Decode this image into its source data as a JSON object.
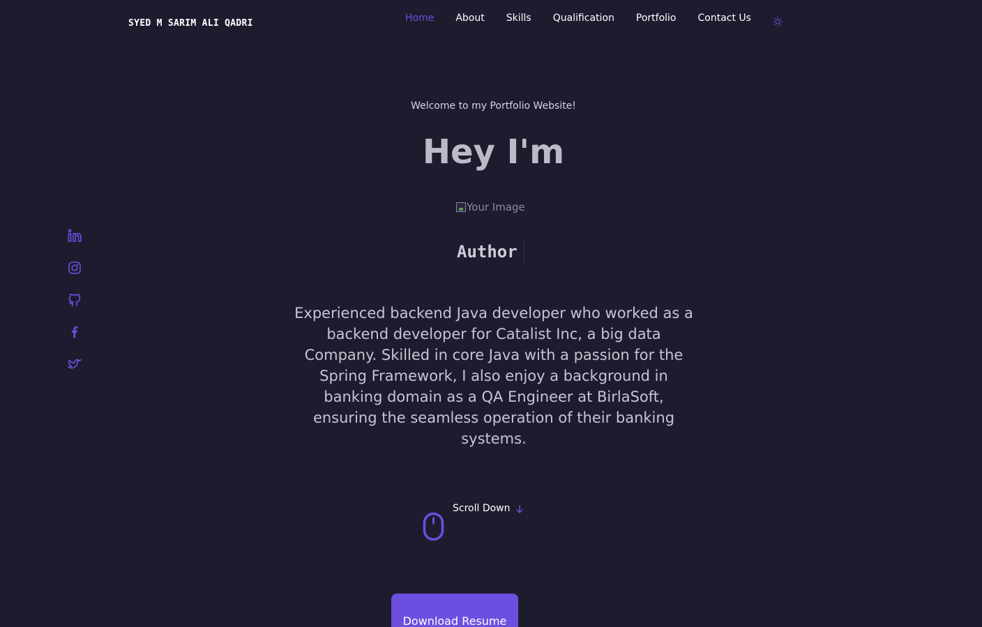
{
  "header": {
    "brand": "SYED M SARIM ALI QADRI",
    "nav": [
      {
        "label": "Home",
        "active": true
      },
      {
        "label": "About"
      },
      {
        "label": "Skills"
      },
      {
        "label": "Qualification"
      },
      {
        "label": "Portfolio"
      },
      {
        "label": "Contact Us"
      }
    ],
    "theme_toggle_icon": "sun-icon"
  },
  "social": {
    "items": [
      {
        "icon": "linkedin-icon"
      },
      {
        "icon": "instagram-icon"
      },
      {
        "icon": "github-icon"
      },
      {
        "icon": "facebook-icon"
      },
      {
        "icon": "twitter-icon"
      }
    ]
  },
  "hero": {
    "welcome": "Welcome to my Portfolio Website!",
    "title": "Hey I'm",
    "image_alt": "Your Image",
    "role": "Author",
    "description": "Experienced backend Java developer who worked as a backend developer for Catalist Inc, a big data Company. Skilled in core Java with a passion for the Spring Framework, I also enjoy a background in banking domain as a QA Engineer at BirlaSoft, ensuring the seamless operation of their banking systems.",
    "scroll_label": "Scroll Down",
    "download_label": "Download Resume"
  },
  "colors": {
    "background": "#1e1b2f",
    "accent": "#6c4fe0",
    "text": "#ffffff"
  }
}
